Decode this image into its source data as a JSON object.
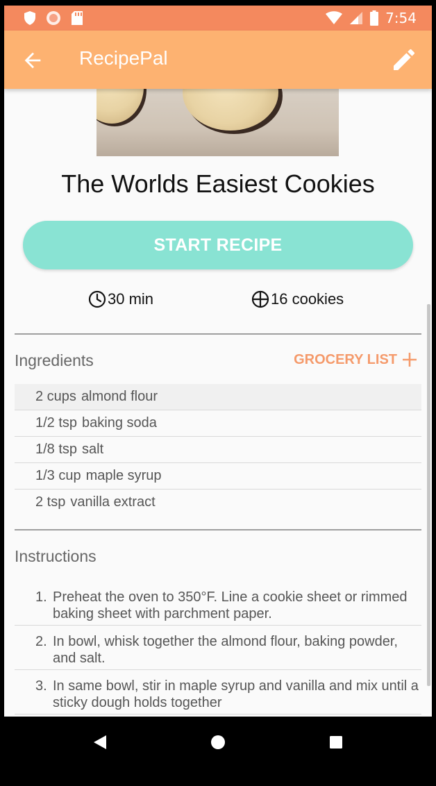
{
  "status_bar": {
    "time": "7:54"
  },
  "app_bar": {
    "title": "RecipePal"
  },
  "recipe": {
    "title": "The Worlds Easiest Cookies",
    "start_button": "START RECIPE",
    "time": "30 min",
    "yield": "16 cookies"
  },
  "ingredients": {
    "header": "Ingredients",
    "grocery_label": "GROCERY LIST",
    "items": [
      {
        "qty": "2 cups",
        "name": "almond flour"
      },
      {
        "qty": "1/2 tsp",
        "name": "baking soda"
      },
      {
        "qty": "1/8 tsp",
        "name": "salt"
      },
      {
        "qty": "1/3 cup",
        "name": "maple syrup"
      },
      {
        "qty": "2 tsp",
        "name": "vanilla extract"
      }
    ]
  },
  "instructions": {
    "header": "Instructions",
    "steps": [
      {
        "num": "1.",
        "text": "Preheat the oven to 350°F. Line a cookie sheet or rimmed baking sheet with parchment paper."
      },
      {
        "num": "2.",
        "text": "In bowl, whisk together the almond flour, baking powder, and salt."
      },
      {
        "num": "3.",
        "text": "In same bowl, stir in maple syrup and vanilla and mix until a sticky dough holds together"
      }
    ]
  },
  "colors": {
    "status_bar": "#f4895e",
    "app_bar": "#fdb271",
    "start_button": "#89e3d3",
    "accent": "#f59a6b"
  },
  "icons": {
    "back": "arrow-left-icon",
    "edit": "pencil-icon",
    "time": "clock-icon",
    "yield": "servings-icon",
    "add": "plus-icon"
  }
}
